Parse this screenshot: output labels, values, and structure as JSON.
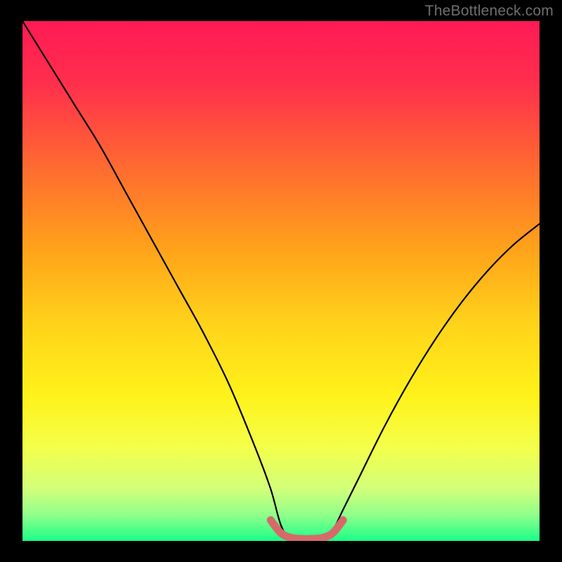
{
  "watermark": "TheBottleneck.com",
  "chart_data": {
    "type": "line",
    "title": "",
    "xlabel": "",
    "ylabel": "",
    "xlim": [
      0,
      100
    ],
    "ylim": [
      0,
      100
    ],
    "series": [
      {
        "name": "bottleneck-curve",
        "x": [
          0,
          5,
          10,
          15,
          20,
          25,
          30,
          35,
          40,
          45,
          48,
          50,
          52,
          55,
          58,
          60,
          62,
          65,
          70,
          75,
          80,
          85,
          90,
          95,
          100
        ],
        "y": [
          100,
          92,
          84,
          76,
          67,
          58,
          49,
          40,
          30,
          18,
          10,
          3,
          0,
          0,
          0,
          2,
          6,
          12,
          22,
          31,
          39,
          46,
          52,
          57,
          61
        ]
      },
      {
        "name": "optimal-marker",
        "x": [
          48,
          50,
          52,
          54,
          56,
          58,
          60,
          62
        ],
        "y": [
          4,
          1.5,
          0.6,
          0.4,
          0.4,
          0.6,
          1.5,
          4
        ]
      }
    ],
    "gradient_stops": [
      {
        "pct": 0.0,
        "color": "#ff1a55"
      },
      {
        "pct": 0.12,
        "color": "#ff2f4c"
      },
      {
        "pct": 0.28,
        "color": "#ff6a30"
      },
      {
        "pct": 0.44,
        "color": "#ffa31a"
      },
      {
        "pct": 0.58,
        "color": "#ffd21a"
      },
      {
        "pct": 0.72,
        "color": "#fff21a"
      },
      {
        "pct": 0.82,
        "color": "#f4ff4a"
      },
      {
        "pct": 0.9,
        "color": "#d2ff7a"
      },
      {
        "pct": 0.95,
        "color": "#90ff8a"
      },
      {
        "pct": 1.0,
        "color": "#1aff88"
      }
    ],
    "curve_color": "#000000",
    "marker_color": "#d66a6a"
  }
}
